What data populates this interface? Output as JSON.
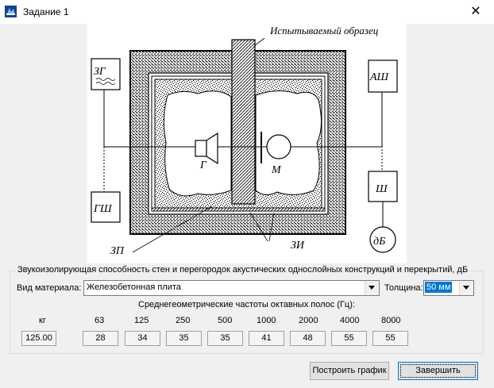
{
  "window": {
    "title": "Задание 1",
    "close_label": "✕",
    "icon": "app-icon"
  },
  "diagram": {
    "specimen_label": "Испытываемый образец",
    "generator_box": "ЗГ",
    "noise_gen_box": "ГШ",
    "analyzer_box": "АШ",
    "amplifier_box": "Ш",
    "db_meter": "дБ",
    "speaker_label": "Г",
    "mic_label": "М",
    "label_zp": "ЗП",
    "label_zi": "ЗИ"
  },
  "group": {
    "title": "Звукоизолирующая способность стен и перегородок акустических однослойных конструкций и перекрытий, дБ",
    "material_label": "Вид материала:",
    "material_value": "Железобетонная плита",
    "thickness_label": "Толщина:",
    "thickness_value": "50 мм",
    "freq_title": "Среднегеометрические частоты октавных полос (Гц):",
    "kg_label": "кг",
    "kg_value": "125.00",
    "frequencies": [
      "63",
      "125",
      "250",
      "500",
      "1000",
      "2000",
      "4000",
      "8000"
    ],
    "values": [
      "28",
      "34",
      "35",
      "35",
      "41",
      "48",
      "55",
      "55"
    ]
  },
  "buttons": {
    "plot": "Построить график",
    "finish": "Завершить"
  }
}
